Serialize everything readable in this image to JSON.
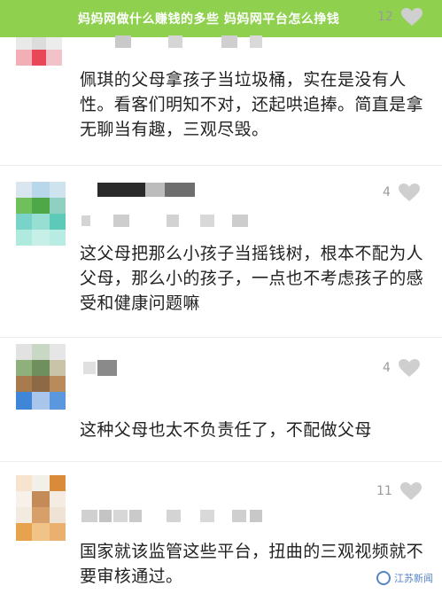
{
  "banner": {
    "title": "妈妈网做什么赚钱的多些 妈妈网平台怎么挣钱"
  },
  "colors": {
    "banner_bg": "#8fd14f",
    "like_icon": "#cfcfcf",
    "like_count": "#9a9a9a",
    "watermark": "#3a6fb8"
  },
  "comments": [
    {
      "avatar": "blurred-avatar",
      "like_count": "12",
      "text": "佩琪的父母拿孩子当垃圾桶，实在是没有人性。看客们明知不对，还起哄追捧。简直是拿无聊当有趣，三观尽毁。"
    },
    {
      "avatar": "blurred-avatar",
      "like_count": "4",
      "text": "这父母把那么小孩子当摇钱树，根本不配为人父母，那么小的孩子，一点也不考虑孩子的感受和健康问题嘛"
    },
    {
      "avatar": "blurred-avatar",
      "like_count": "4",
      "text": "这种父母也太不负责任了，不配做父母"
    },
    {
      "avatar": "blurred-avatar",
      "like_count": "11",
      "text": "国家就该监管这些平台，扭曲的三观视频就不要审核通过。"
    }
  ],
  "watermark": {
    "text": "江苏新闻"
  }
}
